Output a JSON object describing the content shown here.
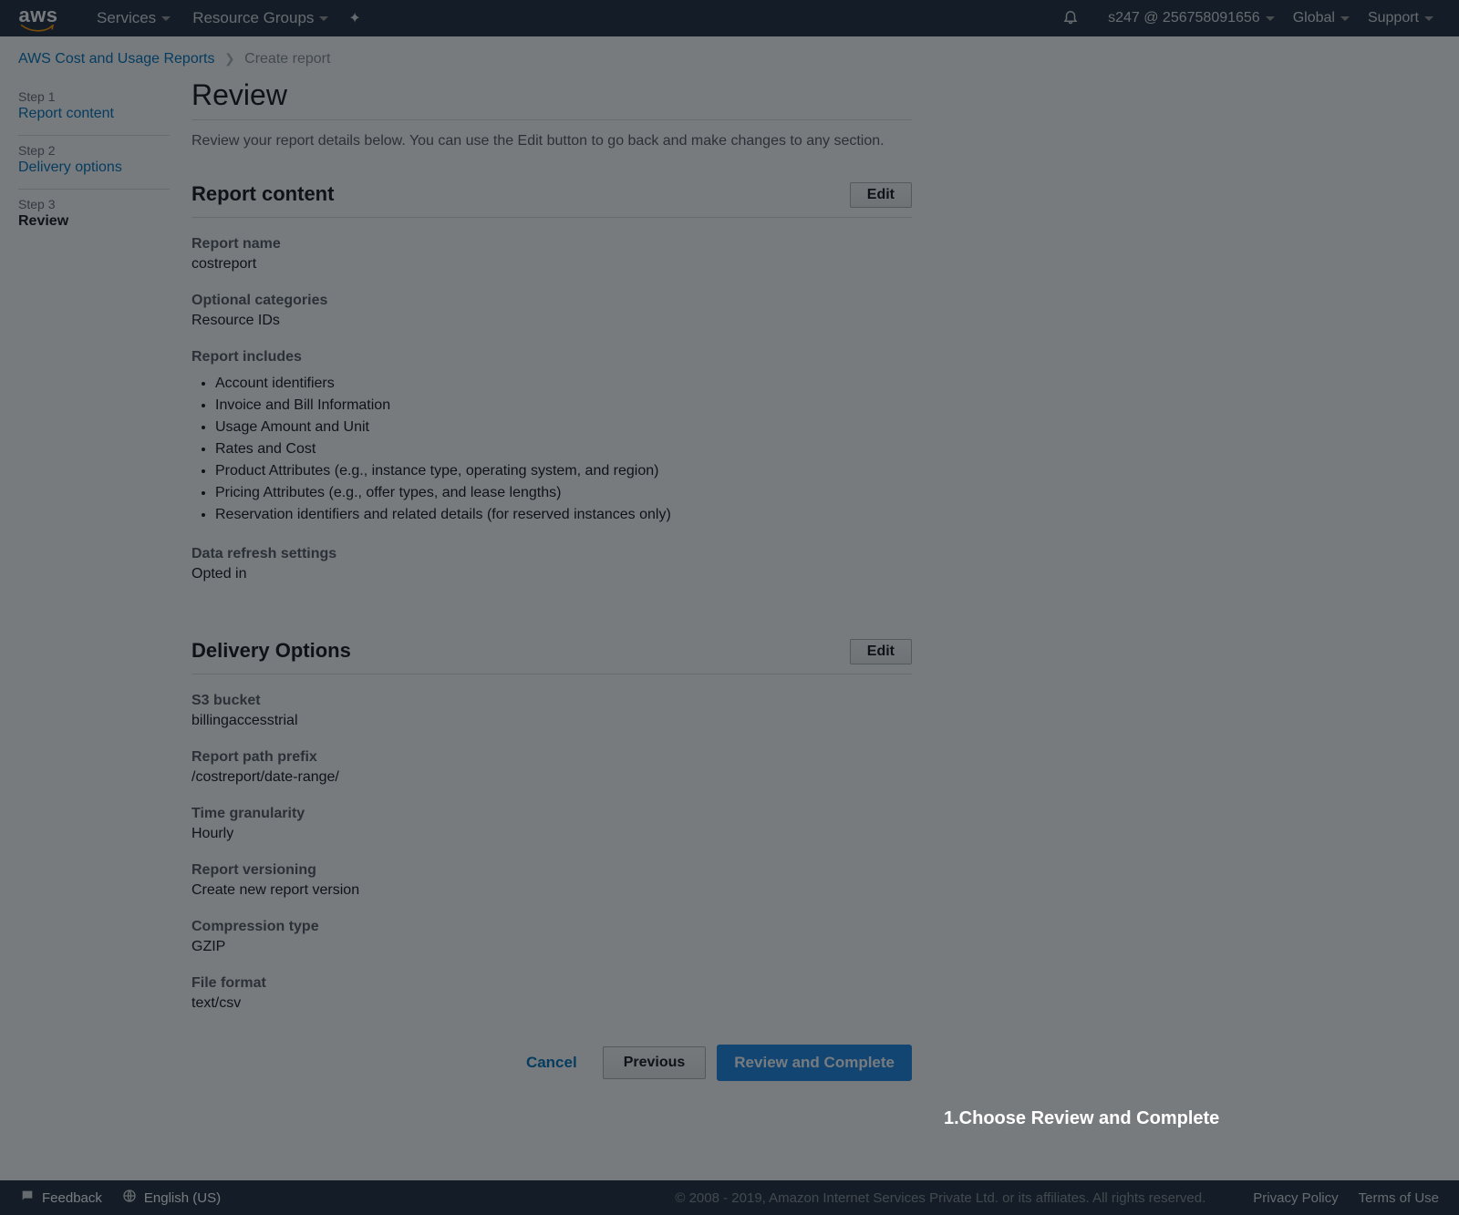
{
  "topnav": {
    "services": "Services",
    "resource_groups": "Resource Groups",
    "account": "s247 @ 256758091656",
    "region": "Global",
    "support": "Support"
  },
  "breadcrumb": {
    "root": "AWS Cost and Usage Reports",
    "current": "Create report"
  },
  "wizard": {
    "step1_label": "Step 1",
    "step1_title": "Report content",
    "step2_label": "Step 2",
    "step2_title": "Delivery options",
    "step3_label": "Step 3",
    "step3_title": "Review"
  },
  "review": {
    "title": "Review",
    "subtitle": "Review your report details below. You can use the Edit button to go back and make changes to any section."
  },
  "report_content": {
    "heading": "Report content",
    "edit": "Edit",
    "report_name_label": "Report name",
    "report_name_value": "costreport",
    "optional_categories_label": "Optional categories",
    "optional_categories_value": "Resource IDs",
    "report_includes_label": "Report includes",
    "includes": {
      "i0": "Account identifiers",
      "i1": "Invoice and Bill Information",
      "i2": "Usage Amount and Unit",
      "i3": "Rates and Cost",
      "i4": "Product Attributes (e.g., instance type, operating system, and region)",
      "i5": "Pricing Attributes (e.g., offer types, and lease lengths)",
      "i6": "Reservation identifiers and related details (for reserved instances only)"
    },
    "data_refresh_label": "Data refresh settings",
    "data_refresh_value": "Opted in"
  },
  "delivery": {
    "heading": "Delivery Options",
    "edit": "Edit",
    "s3_label": "S3 bucket",
    "s3_value": "billingaccesstrial",
    "prefix_label": "Report path prefix",
    "prefix_value": "/costreport/date-range/",
    "granularity_label": "Time granularity",
    "granularity_value": "Hourly",
    "versioning_label": "Report versioning",
    "versioning_value": "Create new report version",
    "compression_label": "Compression type",
    "compression_value": "GZIP",
    "format_label": "File format",
    "format_value": "text/csv"
  },
  "actions": {
    "cancel": "Cancel",
    "previous": "Previous",
    "complete": "Review and Complete"
  },
  "footer": {
    "feedback": "Feedback",
    "language": "English (US)",
    "copyright": "© 2008 - 2019, Amazon Internet Services Private Ltd. or its affiliates. All rights reserved.",
    "privacy": "Privacy Policy",
    "terms": "Terms of Use"
  },
  "callout": {
    "text": "1.Choose Review and Complete"
  }
}
